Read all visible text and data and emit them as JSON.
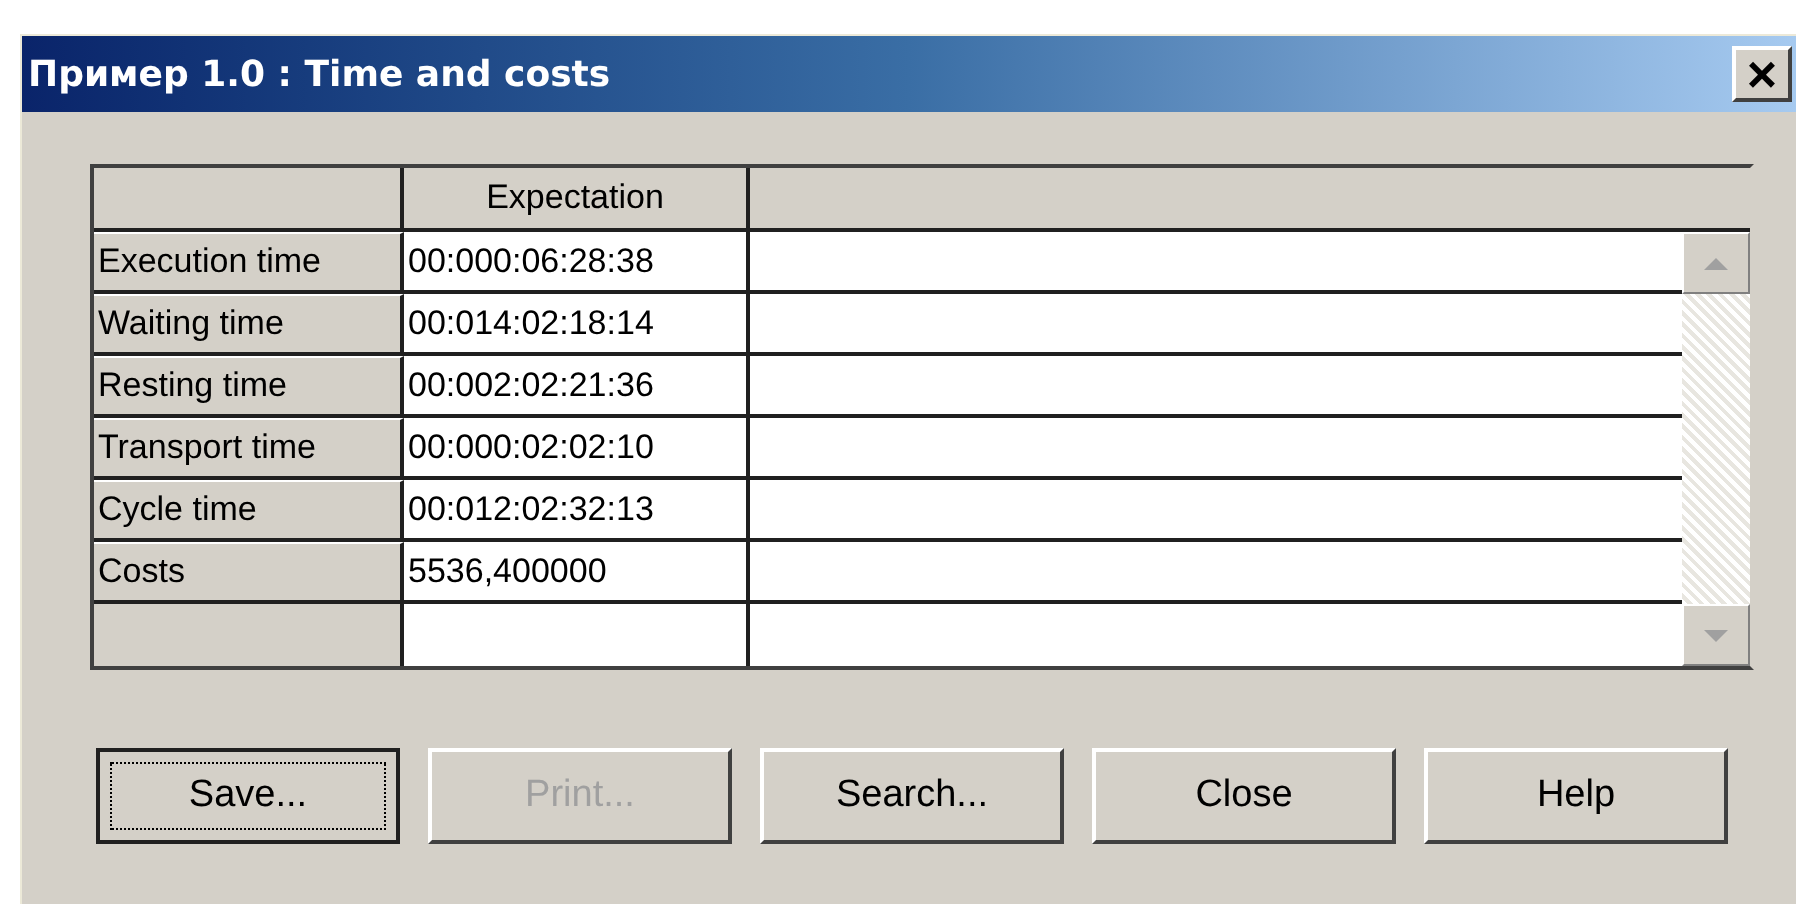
{
  "window": {
    "title": "Пример 1.0 : Time and costs",
    "close": "×"
  },
  "table": {
    "columns": [
      "Expectation"
    ],
    "rows": [
      {
        "label": "Execution time",
        "value": "00:000:06:28:38"
      },
      {
        "label": "Waiting time",
        "value": "00:014:02:18:14"
      },
      {
        "label": "Resting time",
        "value": "00:002:02:21:36"
      },
      {
        "label": "Transport time",
        "value": "00:000:02:02:10"
      },
      {
        "label": "Cycle time",
        "value": "00:012:02:32:13"
      },
      {
        "label": "Costs",
        "value": "5536,400000"
      }
    ]
  },
  "buttons": [
    {
      "label": "Save...",
      "default": true,
      "disabled": false
    },
    {
      "label": "Print...",
      "default": false,
      "disabled": true
    },
    {
      "label": "Search...",
      "default": false,
      "disabled": false
    },
    {
      "label": "Close",
      "default": false,
      "disabled": false
    },
    {
      "label": "Help",
      "default": false,
      "disabled": false
    }
  ]
}
